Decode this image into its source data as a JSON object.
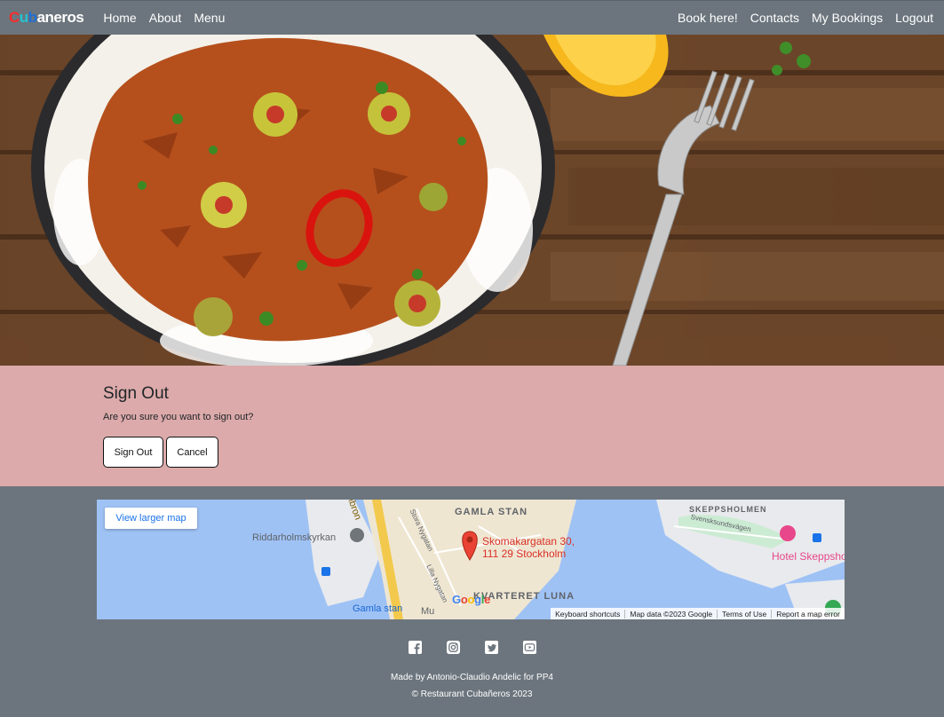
{
  "nav": {
    "brand_letters": [
      {
        "ch": "C",
        "color": "#ff2b2b"
      },
      {
        "ch": "u",
        "color": "#25c3d4"
      },
      {
        "ch": "b",
        "color": "#1f6fd6"
      },
      {
        "ch": "a",
        "color": "#ffffff"
      },
      {
        "ch": "n",
        "color": "#ffffff"
      },
      {
        "ch": "e",
        "color": "#ffffff"
      },
      {
        "ch": "r",
        "color": "#ffffff"
      },
      {
        "ch": "o",
        "color": "#ffffff"
      },
      {
        "ch": "s",
        "color": "#ffffff"
      }
    ],
    "left_links": [
      "Home",
      "About",
      "Menu"
    ],
    "right_links": [
      "Book here!",
      "Contacts",
      "My Bookings",
      "Logout"
    ]
  },
  "signout": {
    "title": "Sign Out",
    "message": "Are you sure you want to sign out?",
    "signout_button": "Sign Out",
    "cancel_button": "Cancel"
  },
  "map": {
    "larger_map": "View larger map",
    "labels": {
      "gamla_stan": "GAMLA STAN",
      "skeppsholmen": "SKEPPSHOLMEN",
      "riddarholmskyrkan": "Riddarholmskyrkan",
      "kvarteret_luna": "KVARTERET LUNA",
      "gamla_stan_station": "Gamla stan",
      "hotel": "Hotel Skeppsho",
      "svensksundsvagen": "Svensksundsvägen",
      "stora_nygatan": "Stora Nygatan",
      "lilla_nygatan": "Lilla Nygatan",
      "bron": "lbron",
      "mu": "Mu"
    },
    "pin_label_line1": "Skomakargatan 30,",
    "pin_label_line2": "111 29 Stockholm",
    "google": "Google",
    "footer": [
      "Keyboard shortcuts",
      "Map data ©2023 Google",
      "Terms of Use",
      "Report a map error"
    ]
  },
  "footer": {
    "socials": [
      "facebook-icon",
      "instagram-icon",
      "twitter-icon",
      "youtube-icon"
    ],
    "credit": "Made by Antonio-Claudio Andelic for PP4",
    "copyright": "© Restaurant Cubañeros 2023"
  }
}
